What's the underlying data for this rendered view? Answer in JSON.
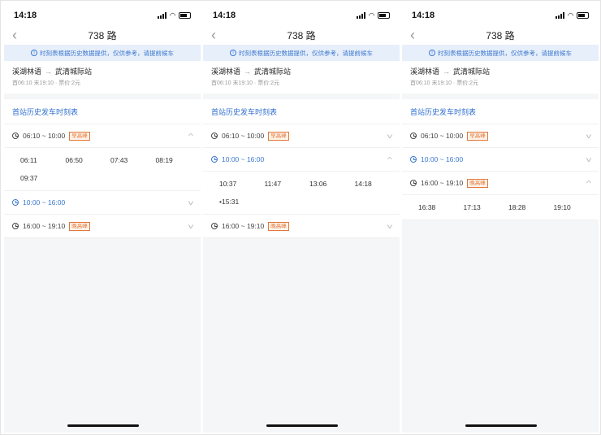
{
  "screens": [
    {
      "time": "14:18",
      "title": "738 路",
      "notice": "时刻表根据历史数据提供，仅供参考，请提前候车",
      "from": "溪湖林语",
      "arrow": "→",
      "to": "武清城际站",
      "meta": "首06:10 末19:10 · 票价:2元",
      "section_title": "首站历史发车时刻表",
      "periods": [
        {
          "range": "06:10 ~ 10:00",
          "tag": "早高峰",
          "expanded": true,
          "active": false,
          "times": [
            "06:11",
            "06:50",
            "07:43",
            "08:19",
            "09:37"
          ]
        },
        {
          "range": "10:00 ~ 16:00",
          "tag": null,
          "expanded": false,
          "active": true,
          "times": []
        },
        {
          "range": "16:00 ~ 19:10",
          "tag": "晚高峰",
          "expanded": false,
          "active": false,
          "times": []
        }
      ]
    },
    {
      "time": "14:18",
      "title": "738 路",
      "notice": "时刻表根据历史数据提供，仅供参考，请提前候车",
      "from": "溪湖林语",
      "arrow": "→",
      "to": "武清城际站",
      "meta": "首06:10 末19:10 · 票价:2元",
      "section_title": "首站历史发车时刻表",
      "periods": [
        {
          "range": "06:10 ~ 10:00",
          "tag": "早高峰",
          "expanded": false,
          "active": false,
          "times": []
        },
        {
          "range": "10:00 ~ 16:00",
          "tag": null,
          "expanded": true,
          "active": true,
          "times": [
            "10:37",
            "11:47",
            "13:06",
            "14:18",
            "•15:31"
          ]
        },
        {
          "range": "16:00 ~ 19:10",
          "tag": "晚高峰",
          "expanded": false,
          "active": false,
          "times": []
        }
      ]
    },
    {
      "time": "14:18",
      "title": "738 路",
      "notice": "时刻表根据历史数据提供，仅供参考，请提前候车",
      "from": "溪湖林语",
      "arrow": "→",
      "to": "武清城际站",
      "meta": "首06:10 末19:10 · 票价:2元",
      "section_title": "首站历史发车时刻表",
      "periods": [
        {
          "range": "06:10 ~ 10:00",
          "tag": "早高峰",
          "expanded": false,
          "active": false,
          "times": []
        },
        {
          "range": "10:00 ~ 16:00",
          "tag": null,
          "expanded": false,
          "active": true,
          "times": []
        },
        {
          "range": "16:00 ~ 19:10",
          "tag": "晚高峰",
          "expanded": true,
          "active": false,
          "times": [
            "16:38",
            "17:13",
            "18:28",
            "19:10"
          ]
        }
      ]
    }
  ],
  "icons": {
    "back": "‹",
    "chev_up": "^",
    "chev_down": "v",
    "info": "i"
  }
}
